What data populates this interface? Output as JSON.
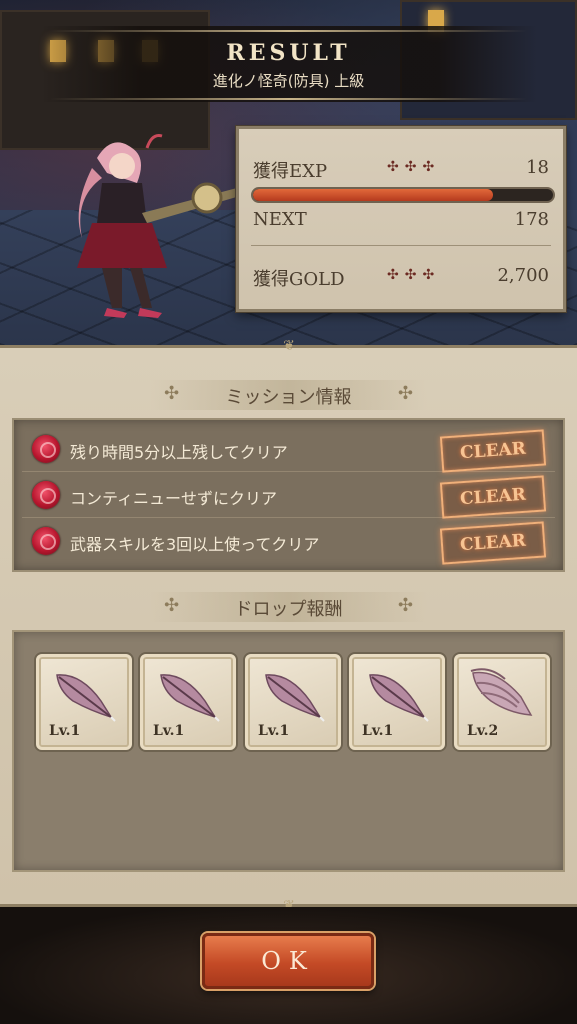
{
  "header": {
    "title": "RESULT",
    "stage_name": "進化ノ怪奇(防具) 上級"
  },
  "stats": {
    "exp_label": "獲得EXP",
    "exp_value": "18",
    "exp_progress": 0.8,
    "next_label": "NEXT",
    "next_value": "178",
    "gold_label": "獲得GOLD",
    "gold_value": "2,700",
    "dots": "✣✣✣"
  },
  "missions": {
    "heading": "ミッション情報",
    "items": [
      {
        "text": "残り時間5分以上残してクリア",
        "status": "CLEAR"
      },
      {
        "text": "コンティニューせずにクリア",
        "status": "CLEAR"
      },
      {
        "text": "武器スキルを3回以上使ってクリア",
        "status": "CLEAR"
      }
    ]
  },
  "drops": {
    "heading": "ドロップ報酬",
    "items": [
      {
        "icon": "feather-icon",
        "level": "Lv.1"
      },
      {
        "icon": "feather-icon",
        "level": "Lv.1"
      },
      {
        "icon": "feather-icon",
        "level": "Lv.1"
      },
      {
        "icon": "feather-icon",
        "level": "Lv.1"
      },
      {
        "icon": "wing-icon",
        "level": "Lv.2"
      }
    ]
  },
  "ok_label": "OK",
  "colors": {
    "accent": "#c44a26",
    "exp_bar": "#e2693a",
    "clear_badge": "#f7c493"
  }
}
